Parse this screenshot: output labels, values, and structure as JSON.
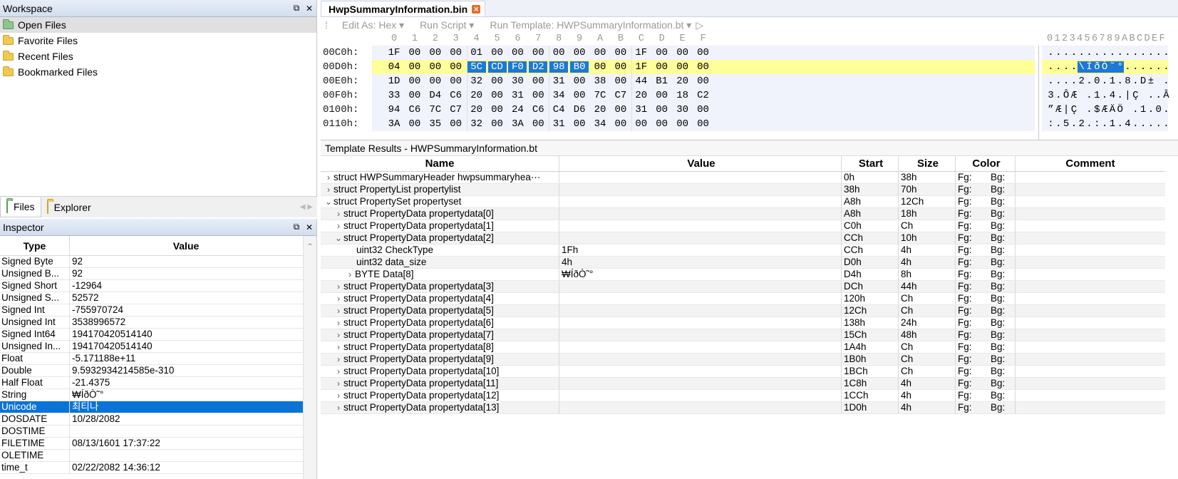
{
  "workspace": {
    "title": "Workspace",
    "items": [
      {
        "label": "Open Files"
      },
      {
        "label": "Favorite Files"
      },
      {
        "label": "Recent Files"
      },
      {
        "label": "Bookmarked Files"
      }
    ],
    "tabs": [
      {
        "label": "Files"
      },
      {
        "label": "Explorer"
      }
    ]
  },
  "inspector": {
    "title": "Inspector",
    "col_type": "Type",
    "col_value": "Value",
    "rows": [
      {
        "type": "Signed Byte",
        "value": "92"
      },
      {
        "type": "Unsigned B...",
        "value": "92"
      },
      {
        "type": "Signed Short",
        "value": "-12964"
      },
      {
        "type": "Unsigned S...",
        "value": "52572"
      },
      {
        "type": "Signed Int",
        "value": "-755970724"
      },
      {
        "type": "Unsigned Int",
        "value": "3538996572"
      },
      {
        "type": "Signed Int64",
        "value": "194170420514140"
      },
      {
        "type": "Unsigned In...",
        "value": "194170420514140"
      },
      {
        "type": "Float",
        "value": "-5.171188e+11"
      },
      {
        "type": "Double",
        "value": "9.5932934214585e-310"
      },
      {
        "type": "Half Float",
        "value": "-21.4375"
      },
      {
        "type": "String",
        "value": "₩ÍðÒ˜°"
      },
      {
        "type": "Unicode",
        "value": "최티나"
      },
      {
        "type": "DOSDATE",
        "value": "10/28/2082"
      },
      {
        "type": "DOSTIME",
        "value": ""
      },
      {
        "type": "FILETIME",
        "value": "08/13/1601 17:37:22"
      },
      {
        "type": "OLETIME",
        "value": ""
      },
      {
        "type": "time_t",
        "value": "02/22/2082 14:36:12"
      }
    ]
  },
  "editor": {
    "file_tab": "HwpSummaryInformation.bin",
    "toolbar": {
      "edit_as": "Edit As: Hex ▾",
      "run_script": "Run Script ▾",
      "run_template": "Run Template: HWPSummaryInformation.bt ▾"
    },
    "hex_header": [
      "0",
      "1",
      "2",
      "3",
      "4",
      "5",
      "6",
      "7",
      "8",
      "9",
      "A",
      "B",
      "C",
      "D",
      "E",
      "F"
    ],
    "ascii_header": "0123456789ABCDEF",
    "lines": [
      {
        "addr": "00C0h:",
        "bytes": [
          "1F",
          "00",
          "00",
          "00",
          "01",
          "00",
          "00",
          "00",
          "00",
          "00",
          "00",
          "00",
          "1F",
          "00",
          "00",
          "00"
        ],
        "ascii": "................"
      },
      {
        "addr": "00D0h:",
        "bytes": [
          "04",
          "00",
          "00",
          "00",
          "5C",
          "CD",
          "F0",
          "D2",
          "98",
          "B0",
          "00",
          "00",
          "1F",
          "00",
          "00",
          "00"
        ],
        "ascii": "....\\ÍðÒ˜°......"
      },
      {
        "addr": "00E0h:",
        "bytes": [
          "1D",
          "00",
          "00",
          "00",
          "32",
          "00",
          "30",
          "00",
          "31",
          "00",
          "38",
          "00",
          "44",
          "B1",
          "20",
          "00"
        ],
        "ascii": "....2.0.1.8.D± ."
      },
      {
        "addr": "00F0h:",
        "bytes": [
          "33",
          "00",
          "D4",
          "C6",
          "20",
          "00",
          "31",
          "00",
          "34",
          "00",
          "7C",
          "C7",
          "20",
          "00",
          "18",
          "C2"
        ],
        "ascii": "3.ÔÆ .1.4.|Ç ..Â"
      },
      {
        "addr": "0100h:",
        "bytes": [
          "94",
          "C6",
          "7C",
          "C7",
          "20",
          "00",
          "24",
          "C6",
          "C4",
          "D6",
          "20",
          "00",
          "31",
          "00",
          "30",
          "00"
        ],
        "ascii": "”Æ|Ç .$ÆÄÖ .1.0."
      },
      {
        "addr": "0110h:",
        "bytes": [
          "3A",
          "00",
          "35",
          "00",
          "32",
          "00",
          "3A",
          "00",
          "31",
          "00",
          "34",
          "00",
          "00",
          "00",
          "00",
          "00"
        ],
        "ascii": ":.5.2.:.1.4....."
      }
    ]
  },
  "template": {
    "title": "Template Results - HWPSummaryInformation.bt",
    "columns": {
      "name": "Name",
      "value": "Value",
      "start": "Start",
      "size": "Size",
      "color": "Color",
      "comment": "Comment"
    },
    "fg_label": "Fg:",
    "bg_label": "Bg:",
    "rows": [
      {
        "name": "struct HWPSummaryHeader hwpsummaryhea···",
        "value": "",
        "start": "0h",
        "size": "38h",
        "twisty": "›"
      },
      {
        "name": "struct PropertyList propertylist",
        "value": "",
        "start": "38h",
        "size": "70h",
        "twisty": "›"
      },
      {
        "name": "struct PropertySet propertyset",
        "value": "",
        "start": "A8h",
        "size": "12Ch",
        "twisty": "⌄"
      },
      {
        "name": "struct PropertyData propertydata[0]",
        "value": "",
        "start": "A8h",
        "size": "18h",
        "twisty": "›"
      },
      {
        "name": "struct PropertyData propertydata[1]",
        "value": "",
        "start": "C0h",
        "size": "Ch",
        "twisty": "›"
      },
      {
        "name": "struct PropertyData propertydata[2]",
        "value": "",
        "start": "CCh",
        "size": "10h",
        "twisty": "⌄"
      },
      {
        "name": "uint32 CheckType",
        "value": "1Fh",
        "start": "CCh",
        "size": "4h",
        "twisty": ""
      },
      {
        "name": "uint32 data_size",
        "value": "4h",
        "start": "D0h",
        "size": "4h",
        "twisty": ""
      },
      {
        "name": "BYTE Data[8]",
        "value": "₩ÍðÒ˜°",
        "start": "D4h",
        "size": "8h",
        "twisty": "›"
      },
      {
        "name": "struct PropertyData propertydata[3]",
        "value": "",
        "start": "DCh",
        "size": "44h",
        "twisty": "›"
      },
      {
        "name": "struct PropertyData propertydata[4]",
        "value": "",
        "start": "120h",
        "size": "Ch",
        "twisty": "›"
      },
      {
        "name": "struct PropertyData propertydata[5]",
        "value": "",
        "start": "12Ch",
        "size": "Ch",
        "twisty": "›"
      },
      {
        "name": "struct PropertyData propertydata[6]",
        "value": "",
        "start": "138h",
        "size": "24h",
        "twisty": "›"
      },
      {
        "name": "struct PropertyData propertydata[7]",
        "value": "",
        "start": "15Ch",
        "size": "48h",
        "twisty": "›"
      },
      {
        "name": "struct PropertyData propertydata[8]",
        "value": "",
        "start": "1A4h",
        "size": "Ch",
        "twisty": "›"
      },
      {
        "name": "struct PropertyData propertydata[9]",
        "value": "",
        "start": "1B0h",
        "size": "Ch",
        "twisty": "›"
      },
      {
        "name": "struct PropertyData propertydata[10]",
        "value": "",
        "start": "1BCh",
        "size": "Ch",
        "twisty": "›"
      },
      {
        "name": "struct PropertyData propertydata[11]",
        "value": "",
        "start": "1C8h",
        "size": "4h",
        "twisty": "›"
      },
      {
        "name": "struct PropertyData propertydata[12]",
        "value": "",
        "start": "1CCh",
        "size": "4h",
        "twisty": "›"
      },
      {
        "name": "struct PropertyData propertydata[13]",
        "value": "",
        "start": "1D0h",
        "size": "4h",
        "twisty": "›"
      }
    ]
  }
}
